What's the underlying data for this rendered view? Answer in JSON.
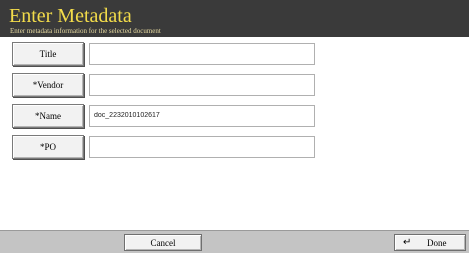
{
  "header": {
    "title": "Enter Metadata",
    "subtitle": "Enter metadata information for the selected document"
  },
  "fields": [
    {
      "label": "Title",
      "value": ""
    },
    {
      "label": "*Vendor",
      "value": ""
    },
    {
      "label": "*Name",
      "value": "doc_2232010102617"
    },
    {
      "label": "*PO",
      "value": ""
    }
  ],
  "footer": {
    "cancel_label": "Cancel",
    "done_label": "Done",
    "done_icon": "return-arrow-icon"
  }
}
